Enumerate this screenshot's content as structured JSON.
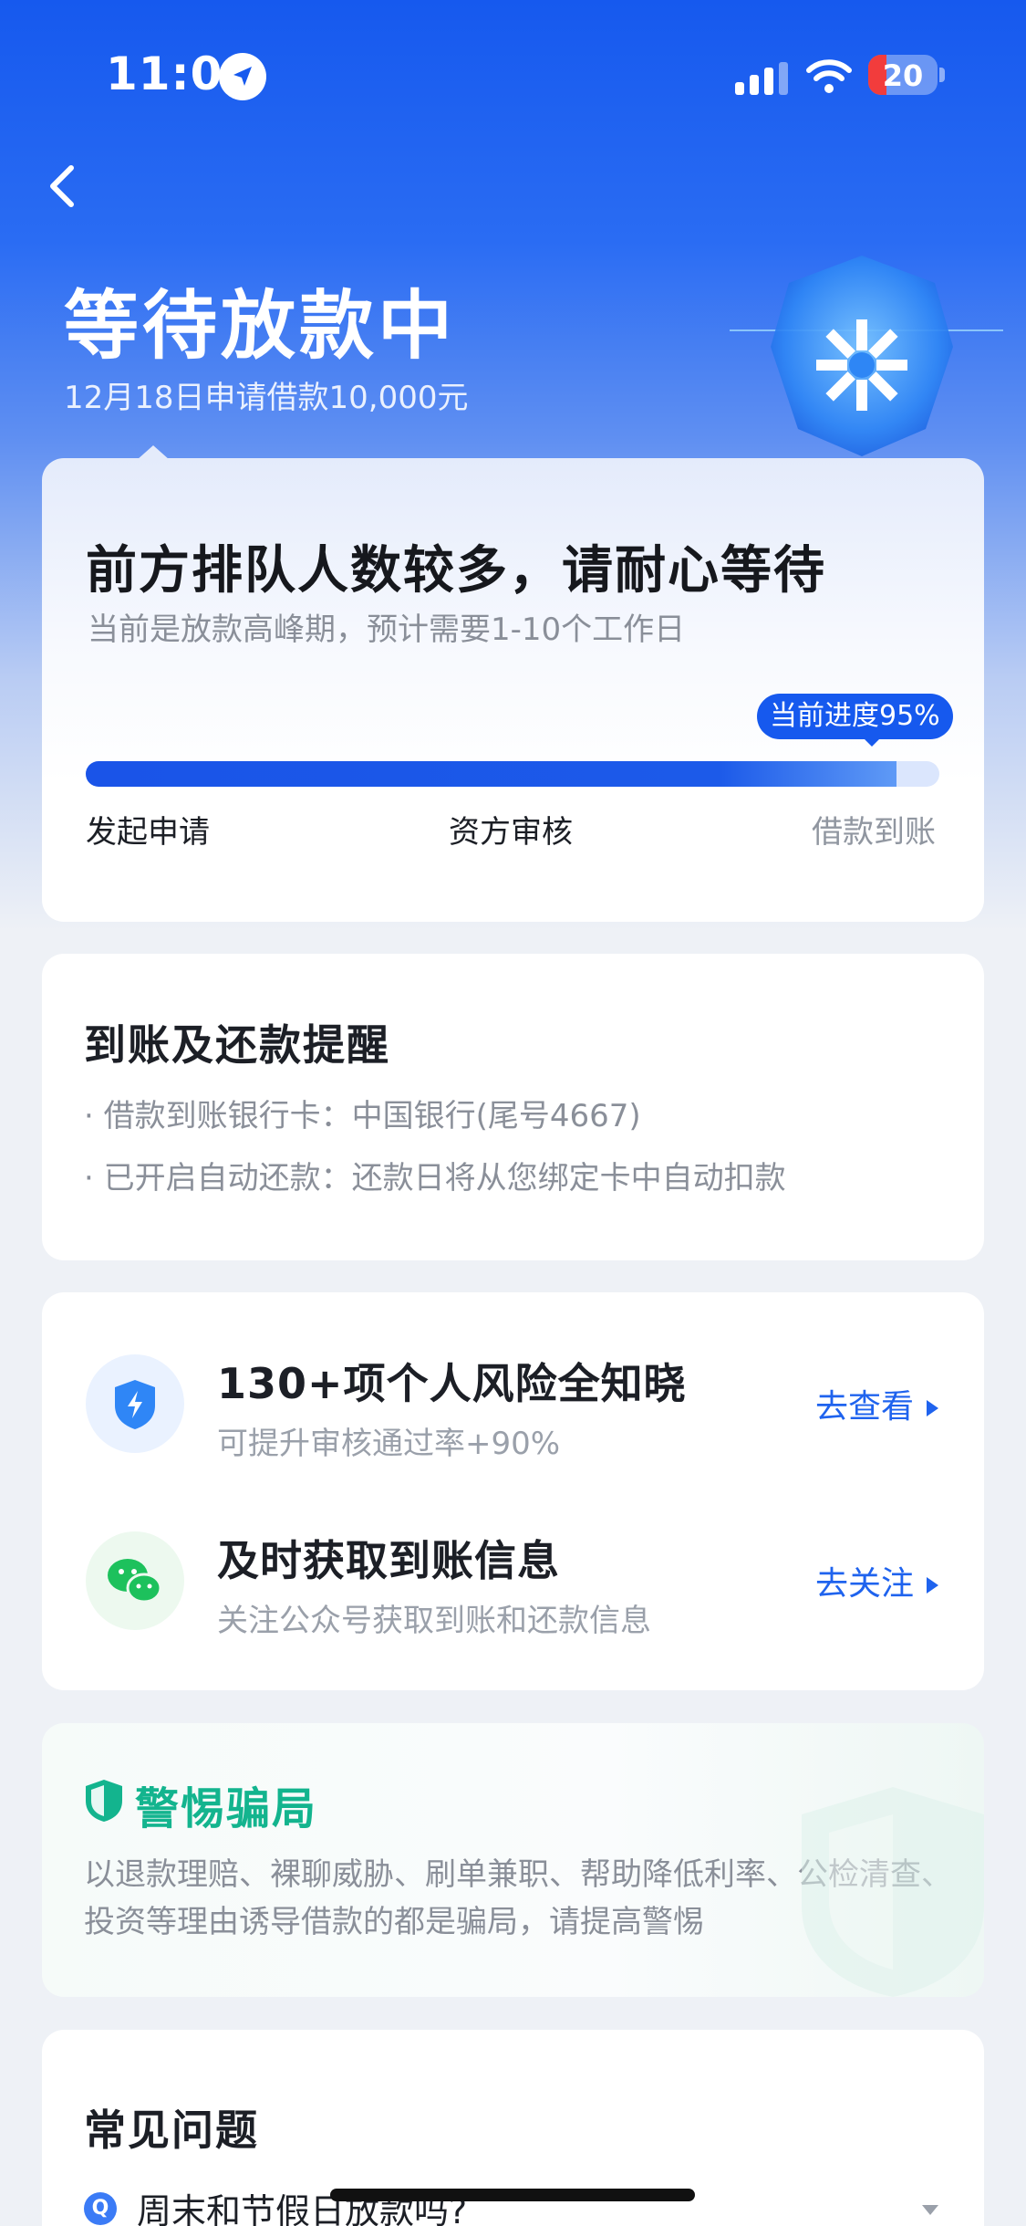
{
  "status_bar": {
    "time": "11:09",
    "battery": "20",
    "icons": [
      "location-arrow-icon",
      "signal-icon",
      "wifi-icon",
      "battery-icon"
    ]
  },
  "header": {
    "back_icon": "chevron-left-icon",
    "title": "等待放款中",
    "subtitle": "12月18日申请借款10,000元"
  },
  "progress": {
    "title": "前方排队人数较多，请耐心等待",
    "subtitle": "当前是放款高峰期，预计需要1-10个工作日",
    "pill": "当前进度95%",
    "percent": 95,
    "steps": [
      "发起申请",
      "资方审核",
      "借款到账"
    ]
  },
  "reminder": {
    "title": "到账及还款提醒",
    "items": [
      "· 借款到账银行卡：中国银行(尾号4667)",
      "· 已开启自动还款：还款日将从您绑定卡中自动扣款"
    ]
  },
  "services": [
    {
      "icon": "shield-lightning-icon",
      "title": "130+项个人风险全知晓",
      "subtitle": "可提升审核通过率+90%",
      "link": "去查看"
    },
    {
      "icon": "wechat-icon",
      "title": "及时获取到账信息",
      "subtitle": "关注公众号获取到账和还款信息",
      "link": "去关注"
    }
  ],
  "fraud_warning": {
    "title": "警惕骗局",
    "text": "以退款理赔、裸聊威胁、刷单兼职、帮助降低利率、公检清查、投资等理由诱导借款的都是骗局，请提高警惕"
  },
  "faq": {
    "title": "常见问题",
    "items": [
      {
        "badge": "Q",
        "question": "周末和节假日放款吗?"
      }
    ]
  },
  "colors": {
    "brand_blue": "#1659ee",
    "link_blue": "#1f63ee",
    "fraud_green": "#13b48e",
    "battery_red": "#f23c3c"
  }
}
